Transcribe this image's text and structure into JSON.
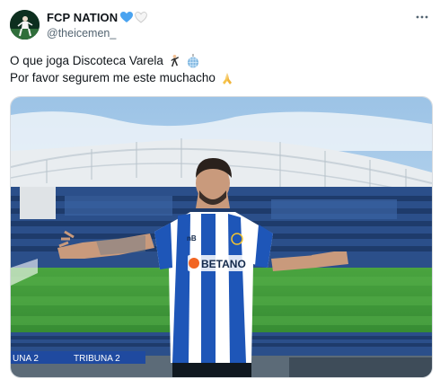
{
  "author": {
    "display_name": "FCP NATION",
    "handle": "@theicemen_",
    "badges": [
      "blue-heart-icon",
      "white-heart-icon"
    ]
  },
  "tweet": {
    "line1": "O que joga Discoteca Varela",
    "line1_emojis": [
      "man-dancing-icon",
      "mirror-ball-icon"
    ],
    "line2": "Por favor segurem me este muchacho",
    "line2_emojis": [
      "folded-hands-icon"
    ]
  },
  "media": {
    "sponsor": "BETANO",
    "stand_sign_left": "UNA 2",
    "stand_sign_right": "TRIBUNA 2"
  },
  "colors": {
    "text": "#0f1419",
    "secondary": "#536471",
    "jersey_blue": "#1e56b8",
    "pitch_green": "#3f9b3c"
  }
}
